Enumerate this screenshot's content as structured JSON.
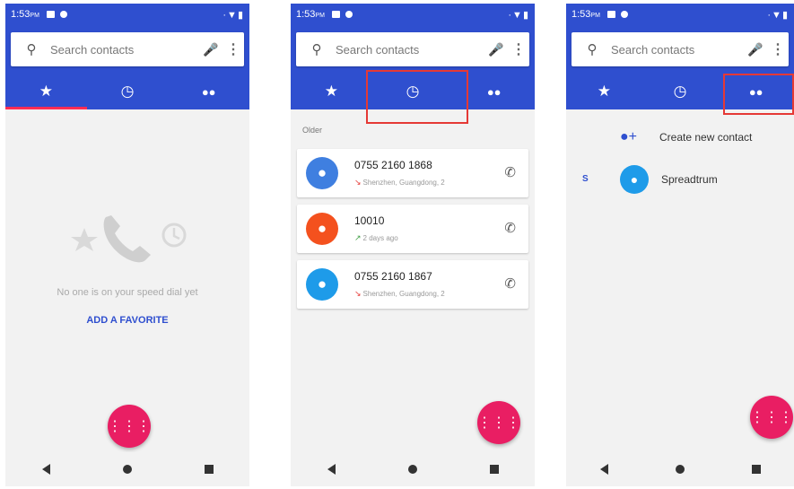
{
  "status_bar": {
    "time": "1:53",
    "time_suffix": "PM",
    "signal": "·▼▮"
  },
  "search": {
    "placeholder": "Search contacts"
  },
  "icons": {
    "search": "search-icon",
    "mic": "mic-icon",
    "more": "more-vert-icon",
    "star": "star-icon",
    "clock": "clock-icon",
    "people": "people-icon",
    "phone": "phone-icon",
    "dialpad": "dialpad-icon"
  },
  "colors": {
    "app_bar": "#2f4fcf",
    "accent": "#e91e63",
    "tab_indicator": "#ff2d55",
    "highlight": "#e53935"
  },
  "phone1": {
    "active_tab": "speed_dial",
    "empty_message": "No one is on your speed dial yet",
    "add_favorite": "ADD A FAVORITE"
  },
  "phone2": {
    "active_tab": "recents",
    "section_label": "Older",
    "calls": [
      {
        "number": "0755 2160 1868",
        "detail": "Shenzhen, Guangdong, 2",
        "avatar_color": "#3f7fe0",
        "call_type": "missed"
      },
      {
        "number": "10010",
        "detail": "2 days ago",
        "avatar_color": "#f4511e",
        "call_type": "outgoing"
      },
      {
        "number": "0755 2160 1867",
        "detail": "Shenzhen, Guangdong, 2",
        "avatar_color": "#1e9be9",
        "call_type": "missed"
      }
    ]
  },
  "phone3": {
    "active_tab": "contacts",
    "create_contact": "Create new contact",
    "index_letter": "S",
    "contacts": [
      {
        "name": "Spreadtrum",
        "avatar_color": "#1e9be9"
      }
    ]
  }
}
